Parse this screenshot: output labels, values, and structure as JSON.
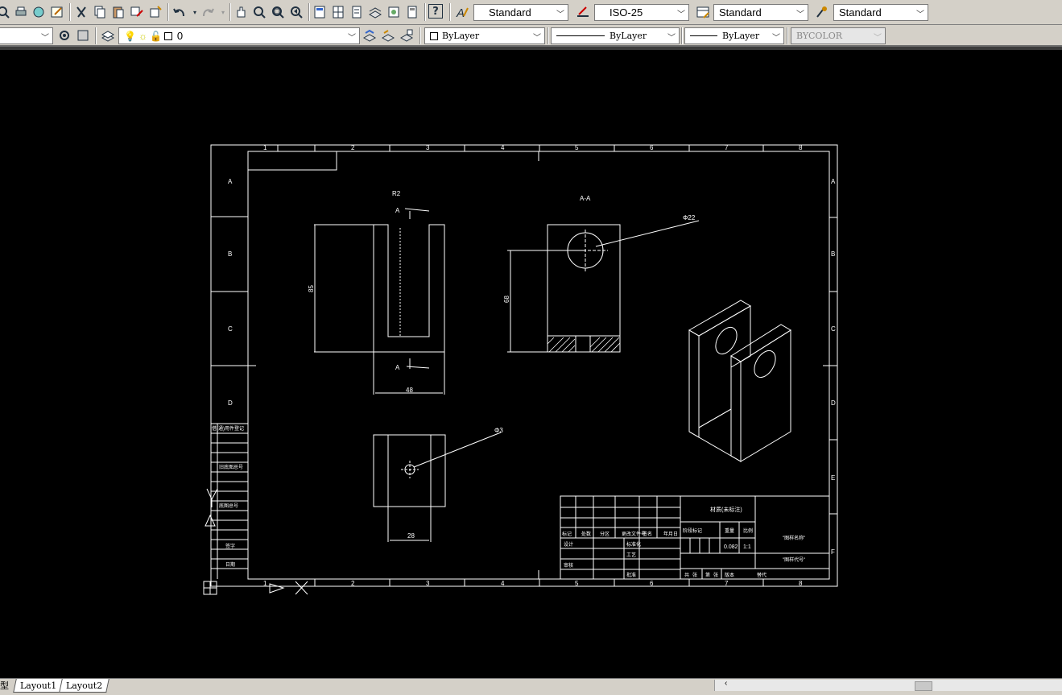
{
  "toolbar1": {
    "text_style": "Standard",
    "dim_style": "ISO-25",
    "table_style": "Standard",
    "multileader_style": "Standard",
    "help_glyph": "?"
  },
  "toolbar2": {
    "layer_name": "0",
    "color": "ByLayer",
    "linetype": "ByLayer",
    "lineweight": "ByLayer",
    "plotstyle": "BYCOLOR"
  },
  "tabs": {
    "model_partial": "型",
    "layout1": "Layout1",
    "layout2": "Layout2"
  },
  "drawing": {
    "column_numbers": [
      "1",
      "2",
      "3",
      "4",
      "5",
      "6",
      "7",
      "8"
    ],
    "row_letters": [
      "A",
      "B",
      "C",
      "D"
    ],
    "row_letters_right": [
      "A",
      "B",
      "C",
      "D",
      "E",
      "F"
    ],
    "section_label": "A-A",
    "section_mark": "A",
    "dims": {
      "front_height": "85",
      "front_width": "48",
      "section_height": "68",
      "hole_diam_big": "Φ22",
      "hole_diam_small": "Φ3",
      "top_width": "28",
      "radius": "R2"
    },
    "title_block": {
      "material": "材质(未标注)",
      "weight": "0.082",
      "scale": "1:1",
      "name_placeholder": "\"图样名称\"",
      "code_placeholder": "\"图样代号\"",
      "labels": [
        "标记",
        "处数",
        "分区",
        "更改文件号",
        "签名",
        "年月日",
        "设计",
        "标准化",
        "审核",
        "工艺",
        "批准",
        "阶段标记",
        "重量",
        "比例",
        "共",
        "张",
        "第",
        "张",
        "版本",
        "替代"
      ]
    },
    "left_block_labels": [
      "借(通)用件登记",
      "旧底图总号",
      "底图总号",
      "签字",
      "日期"
    ]
  },
  "colors": {
    "toolbar_bg": "#d4d0c8",
    "canvas_bg": "#000000",
    "line": "#ffffff"
  }
}
